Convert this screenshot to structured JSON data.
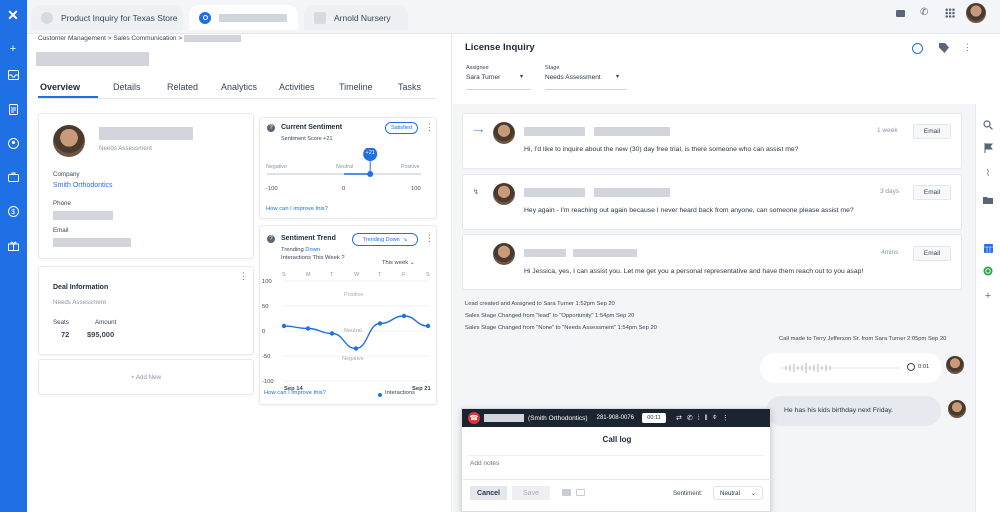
{
  "tabs": [
    {
      "label": "Product Inquiry for Texas Store"
    },
    {
      "label": ""
    },
    {
      "label": "Arnold Nursery"
    }
  ],
  "breadcrumb": "Customer Management  > Sales Communication >",
  "left_tabs": [
    "Overview",
    "Details",
    "Related",
    "Analytics",
    "Activities",
    "Timeline",
    "Tasks"
  ],
  "contact": {
    "status": "Needs Assessment",
    "company_label": "Company",
    "company": "Smith Orthodontics",
    "phone_label": "Phone",
    "email_label": "Email"
  },
  "deal": {
    "title": "Deal Information",
    "status": "Needs Assessment",
    "seats_label": "Seats",
    "seats": "72",
    "amount_label": "Amount",
    "amount": "$95,000",
    "add_new": "+ Add New"
  },
  "sentiment": {
    "title": "Current Sentiment",
    "badge": "Satisfied",
    "score": "Sentiment Score +21",
    "marker": "+21",
    "neg": "Negative",
    "neu": "Neutral",
    "pos": "Positive",
    "min": "-100",
    "mid": "0",
    "max": "100",
    "value": 21,
    "help": "How can I improve this?"
  },
  "trend": {
    "title": "Sentiment Trend",
    "badge": "Trending Down",
    "line1_prefix": "Trending ",
    "line1_value": "Down",
    "line2": "Interactions This Week ?",
    "period": "This week",
    "days": [
      "S",
      "M",
      "T",
      "W",
      "T",
      "F",
      "S"
    ],
    "yticks": [
      "100",
      "50",
      "0",
      "-50",
      "-100"
    ],
    "zone_pos": "Positive",
    "zone_neu": "Neutral",
    "zone_neg": "Negative",
    "x_start": "Sep 14",
    "x_end": "Sep 21",
    "help": "How can I improve this?",
    "legend": "Interactions"
  },
  "chart_data": {
    "type": "line",
    "x": [
      "S",
      "M",
      "T",
      "W",
      "T",
      "F",
      "S"
    ],
    "series": [
      {
        "name": "Interactions",
        "values": [
          10,
          5,
          -5,
          -35,
          15,
          30,
          10
        ]
      }
    ],
    "ylim": [
      -100,
      100
    ]
  },
  "inquiry": {
    "title": "License Inquiry",
    "assignee_label": "Assignee",
    "assignee": "Sara Turner",
    "stage_label": "Stage",
    "stage": "Needs Assessment"
  },
  "messages": [
    {
      "time": "1 week",
      "text": "Hi, I'd like to inquire about the new (30) day free trial, is there someone who can assist me?",
      "button": "Email"
    },
    {
      "time": "3 days",
      "text": "Hey again - I'm reaching out again because I never heard back from anyone, can someone please assist me?",
      "button": "Email"
    },
    {
      "time": "4mins",
      "text": "Hi Jessica, yes, I can assist you.  Let me get you a personal representative and have them reach out to you asap!",
      "button": "Email"
    }
  ],
  "system_lines": [
    "Lead created and Assigned to Sara Turner 1:52pm Sep 20",
    "Sales Stage Changed from \"lead\" to \"Opportunity\" 1:54pm Sep 20",
    "Sales Stage Changed from \"None\" to \"Needs Assessment\" 1:54pm Sep 20"
  ],
  "call_note": "Call made to Terry Jefferson Sr. from Sara Turner 2:05pm Sep 20",
  "audio_time": "0:01",
  "note_bubble": "He has his kids birthday next Friday.",
  "call": {
    "company": "(Smith Orthodontics)",
    "number": "281-908-0076",
    "timer": "00:11",
    "title": "Call log",
    "placeholder": "Add notes",
    "cancel": "Cancel",
    "save": "Save",
    "sentiment_label": "Sentiment:",
    "sentiment_value": "Neutral"
  }
}
